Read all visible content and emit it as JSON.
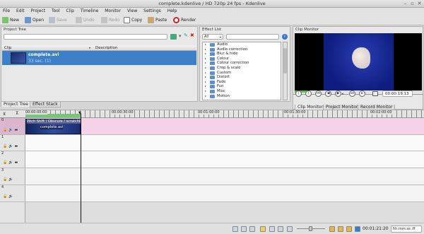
{
  "window": {
    "title": "complete.kdenlive / HD 720p 24 fps - Kdenlive"
  },
  "menu": [
    "File",
    "Edit",
    "Project",
    "Tool",
    "Clip",
    "Timeline",
    "Monitor",
    "View",
    "Settings",
    "Help"
  ],
  "toolbar": {
    "new": "New",
    "open": "Open",
    "save": "Save",
    "undo": "Undo",
    "redo": "Redo",
    "copy": "Copy",
    "paste": "Paste",
    "render": "Render"
  },
  "project_tree": {
    "title": "Project Tree",
    "col_clip": "Clip",
    "col_desc": "Description",
    "clip_name": "complete.avi",
    "clip_info": "33 sec. (1)"
  },
  "effect_list": {
    "title": "Effect List",
    "filter": "All",
    "items": [
      "Audio",
      "Audio correction",
      "Blur & hide",
      "Colour",
      "Colour correction",
      "Crop & scale",
      "Custom",
      "Distort",
      "Fade",
      "Fun",
      "Misc",
      "Motion"
    ]
  },
  "clip_monitor": {
    "title": "Clip Monitor",
    "timecode": "00:00:19:13",
    "tabs": [
      "Clip Monitor",
      "Project Monitor",
      "Record Monitor"
    ]
  },
  "left_tabs": [
    "Project Tree",
    "Effect Stack"
  ],
  "timeline": {
    "ruler": [
      "00:00:00:00",
      "00:00:30:00",
      "00:01:00:00",
      "00:01:30:00",
      "00:02:00:00"
    ],
    "clip_effects": "Pitch Shift / Obscure / scratchlines",
    "clip_name": "complete.avi",
    "tracks": [
      "0",
      "1",
      "2",
      "3",
      "4"
    ]
  },
  "status": {
    "timecode": "00:01:21:20",
    "format": "hh:mm:ss::ff"
  }
}
